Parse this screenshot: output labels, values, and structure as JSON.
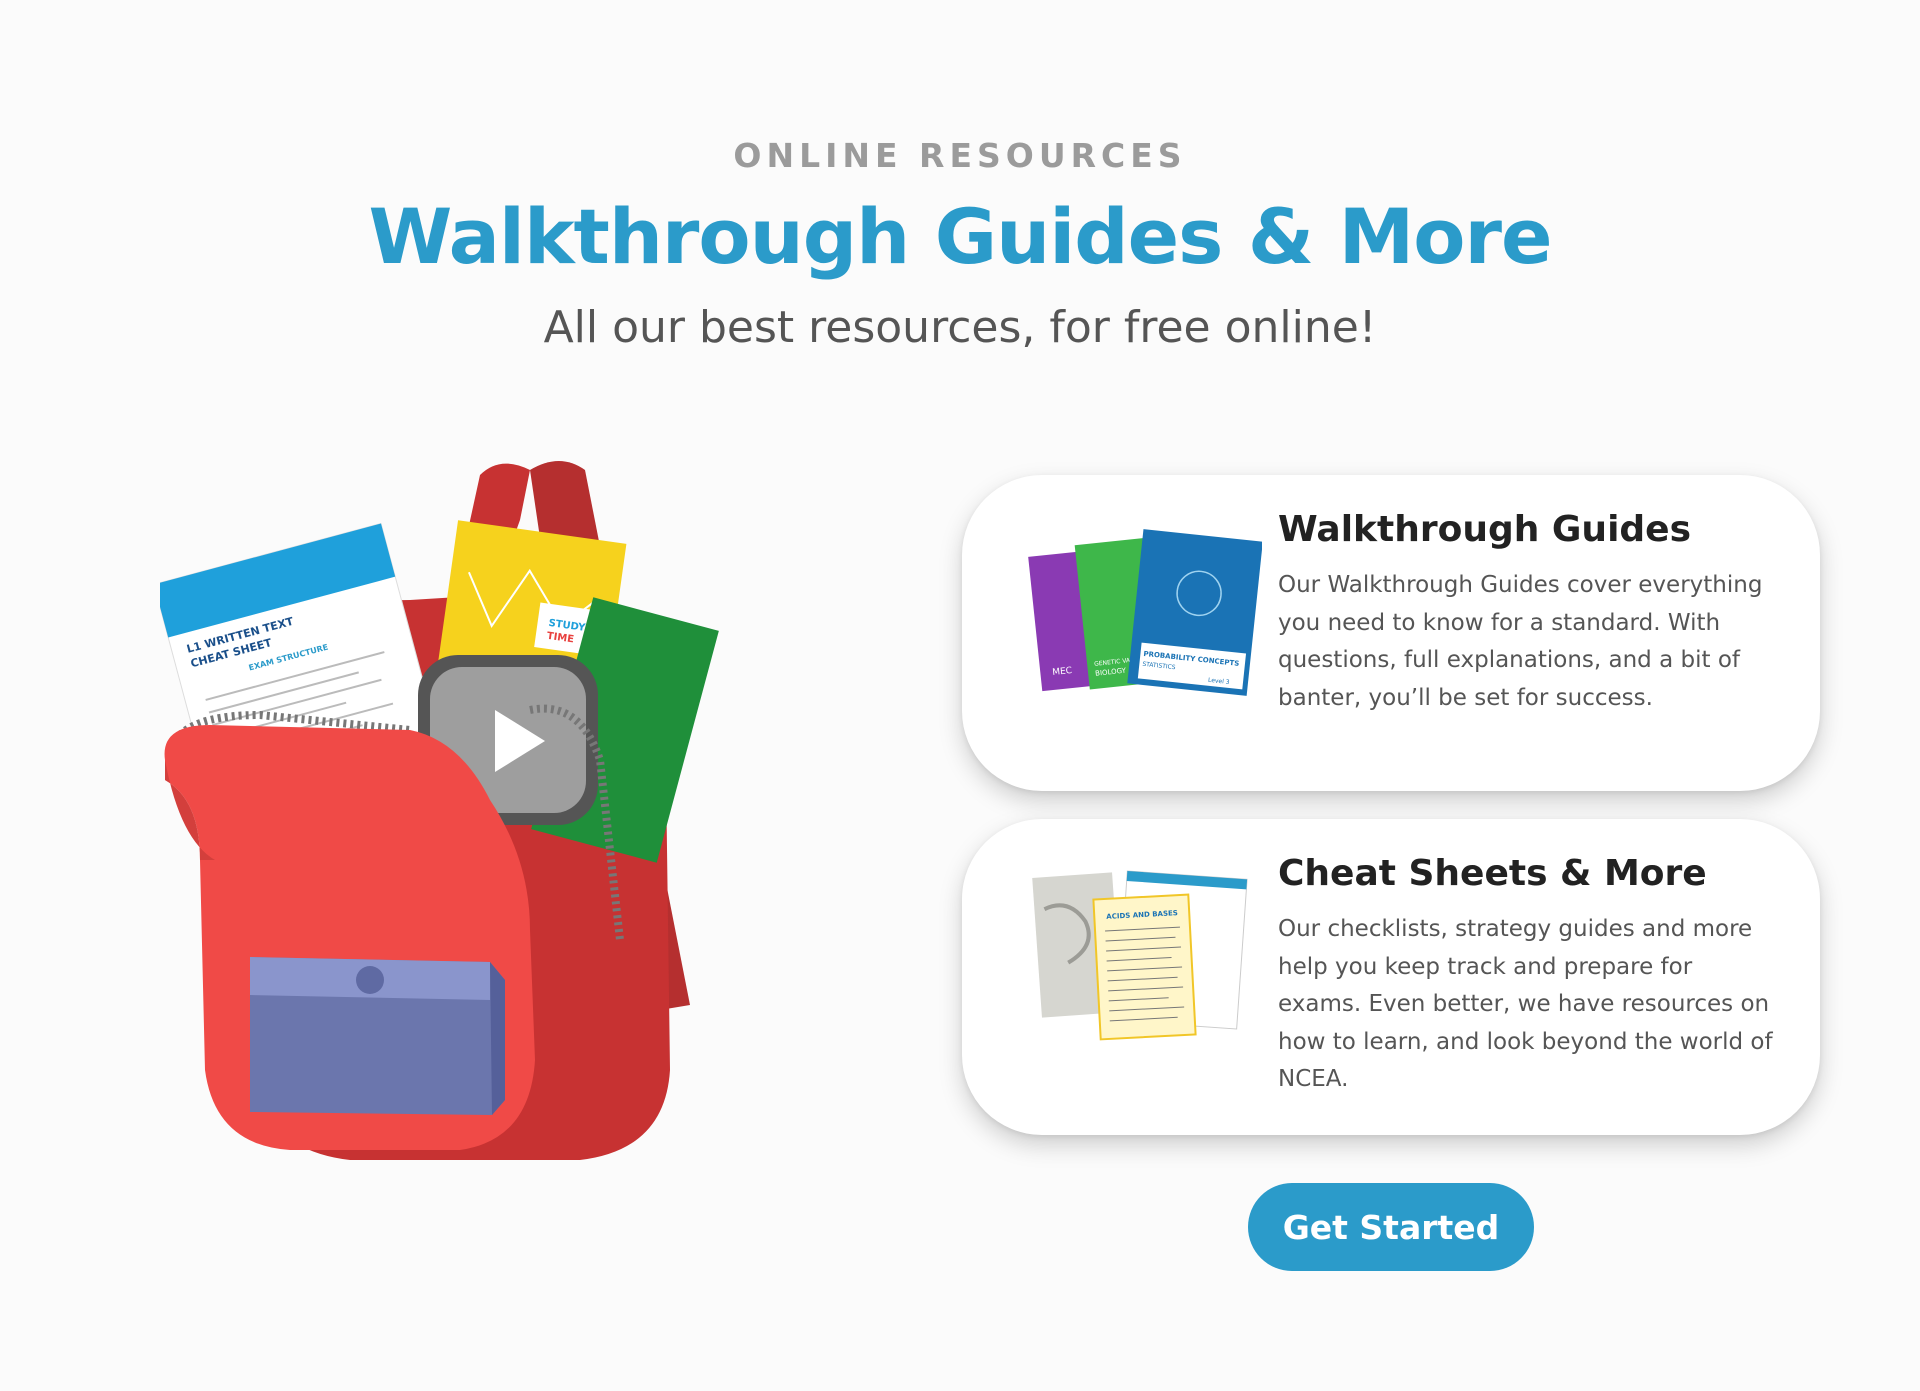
{
  "header": {
    "eyebrow": "ONLINE RESOURCES",
    "title": "Walkthrough Guides & More",
    "subtitle": "All our best resources, for free online!"
  },
  "illustration": {
    "name": "backpack-with-resources",
    "sheet_text": [
      "L1 WRITTEN TEXT",
      "CHEAT SHEET",
      "EXAM STRUCTURE",
      "STUDY",
      "TIME"
    ]
  },
  "cards": [
    {
      "title": "Walkthrough Guides",
      "description": "Our Walkthrough Guides cover everything you need to know for a standard. With questions, full explanations, and a bit of banter, you’ll be set for success.",
      "thumbnail": {
        "icon": "guide-books-icon",
        "book_labels": [
          "MEC",
          "GENETIC VARIA",
          "BIOLOGY",
          "PROBABILITY CONCEPTS",
          "STATISTICS",
          "Level 3"
        ]
      }
    },
    {
      "title": "Cheat Sheets & More",
      "description": "Our checklists, strategy guides and more help you keep track and prepare for exams. Even better, we have resources on how to learn, and look beyond the world of NCEA.",
      "thumbnail": {
        "icon": "cheat-sheets-icon",
        "sheet_labels": [
          "ACIDS AND BASES"
        ]
      }
    }
  ],
  "cta": {
    "label": "Get Started"
  },
  "colors": {
    "accent": "#2b9bca",
    "backpack_red": "#e8413e",
    "pocket_blue": "#7b86c0",
    "heading": "#222222",
    "body": "#555555",
    "eyebrow": "#9b9b9b"
  }
}
